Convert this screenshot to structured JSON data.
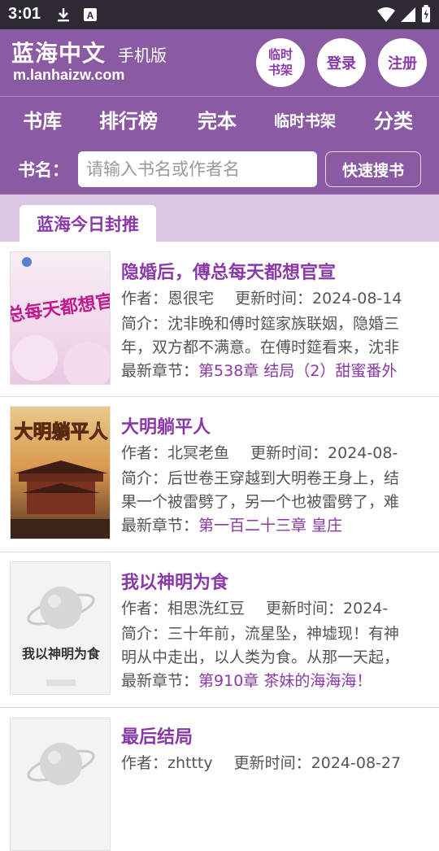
{
  "status_bar": {
    "time": "3:01"
  },
  "header": {
    "site_name": "蓝海中文",
    "site_sub": "手机版",
    "site_url": "m.lanhaizw.com",
    "buttons": {
      "temp_shelf": "临时书架",
      "login": "登录",
      "register": "注册"
    }
  },
  "nav": [
    "书库",
    "排行榜",
    "完本",
    "临时书架",
    "分类"
  ],
  "search": {
    "label": "书名：",
    "placeholder": "请输入书名或作者名",
    "button": "快速搜书"
  },
  "section": {
    "title": "蓝海今日封推"
  },
  "labels": {
    "author": "作者：",
    "updated": "更新时间：",
    "intro": "简介：",
    "latest": "最新章节："
  },
  "books": [
    {
      "title": "隐婚后，傅总每天都想官宣",
      "author": "恩很宅",
      "updated": "2024-08-14",
      "intro_line1": "沈非晚和傅时筵家族联姻，隐婚三",
      "intro_line2": "年，双方都不满意。在傅时筵看来，沈非",
      "latest": "第538章 结局（2）甜蜜番外",
      "cover_text": "傅总每天都想官宣"
    },
    {
      "title": "大明躺平人",
      "author": "北冥老鱼",
      "updated": "2024-08-",
      "intro_line1": "后世卷王穿越到大明卷王身上，结",
      "intro_line2": "果一个被雷劈了，另一个也被雷劈了，难",
      "latest": "第一百二十三章 皇庄",
      "cover_text": "大明躺平人"
    },
    {
      "title": "我以神明为食",
      "author": "相思洗红豆",
      "updated": "2024-",
      "intro_line1": "三十年前，流星坠，神墟现！有神",
      "intro_line2": "明从中走出，以人类为食。从那一天起，",
      "latest": "第910章 茶妹的海海海！",
      "cover_text": "我以神明为食"
    },
    {
      "title": "最后结局",
      "author": "zhttty",
      "updated": "2024-08-27"
    }
  ]
}
